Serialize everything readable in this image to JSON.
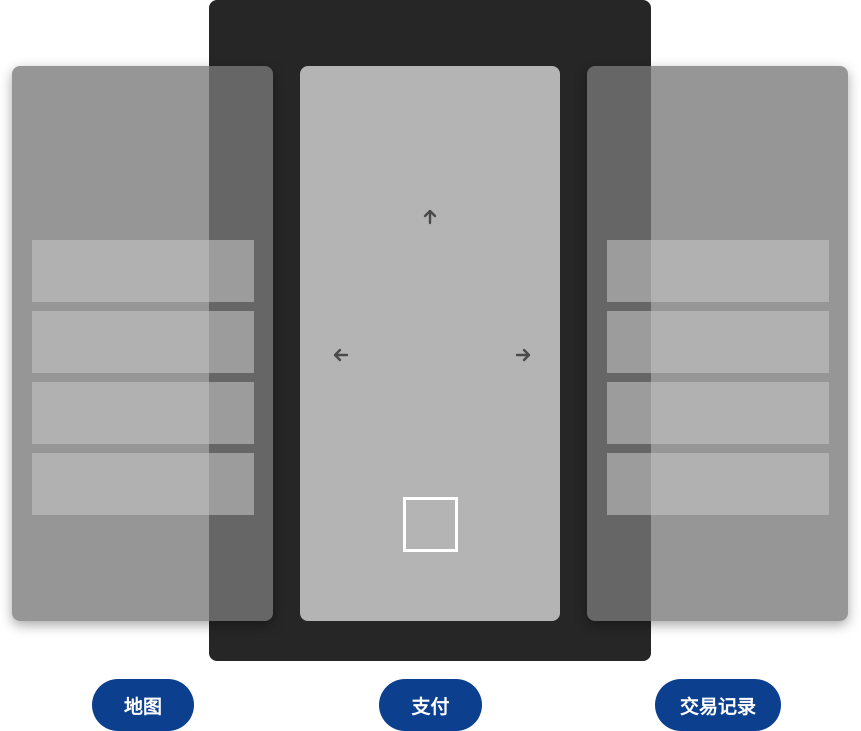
{
  "tabs": [
    {
      "label": "地图"
    },
    {
      "label": "支付"
    },
    {
      "label": "交易记录"
    }
  ],
  "gesture_hints": {
    "up": "arrow-up-icon",
    "left": "arrow-left-icon",
    "right": "arrow-right-icon",
    "tap_target": "square-frame"
  },
  "colors": {
    "device": "#262626",
    "active_card": "#b4b4b4",
    "side_card": "#787878",
    "pill": "#0d3f8f"
  }
}
